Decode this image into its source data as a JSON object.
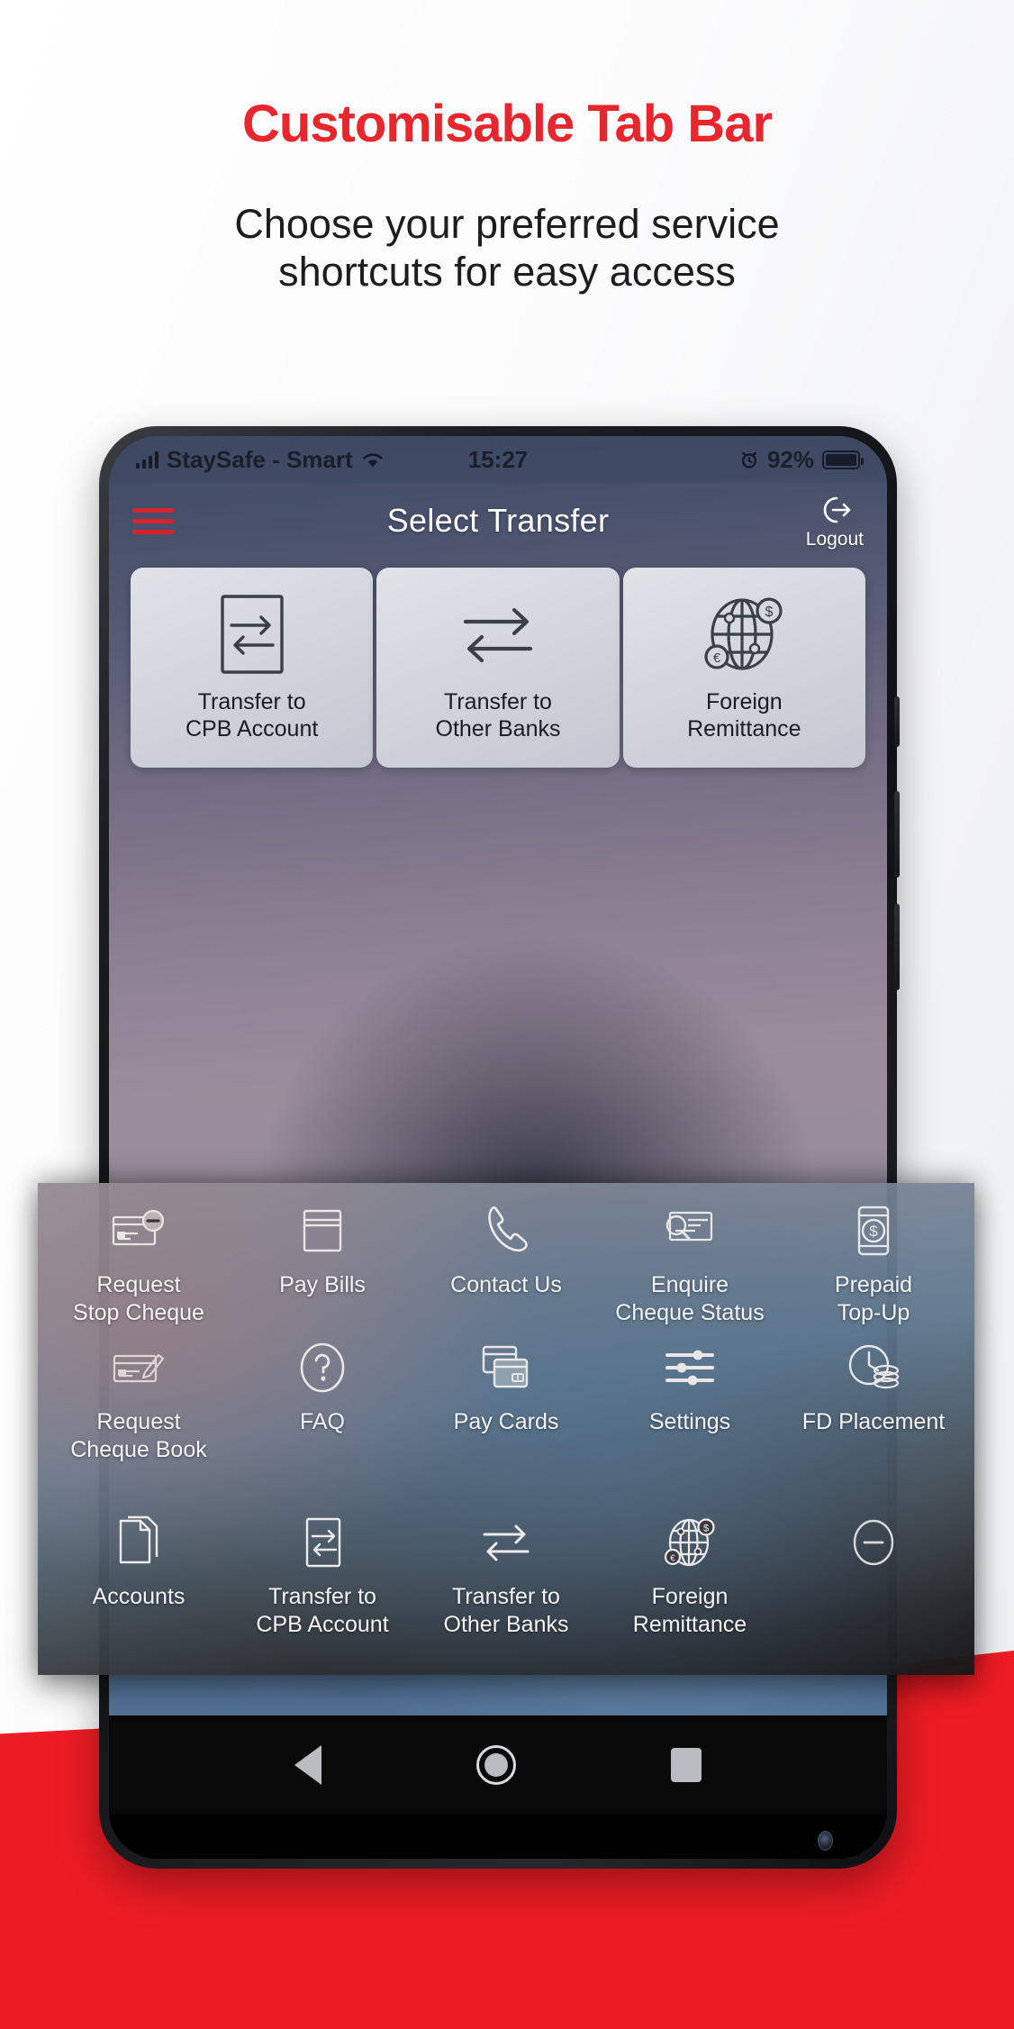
{
  "promo": {
    "title": "Customisable Tab Bar",
    "subtitle_line1": "Choose your preferred service",
    "subtitle_line2": "shortcuts for easy access",
    "title_color": "#e8262d",
    "band_color": "#ed1c24"
  },
  "status_bar": {
    "carrier": "StaySafe - Smart",
    "signal_icon": "signal-bars-icon",
    "wifi_icon": "wifi-icon",
    "time": "15:27",
    "alarm_icon": "alarm-clock-icon",
    "battery_percent": "92%",
    "battery_icon": "battery-full-icon"
  },
  "app_header": {
    "menu_icon": "hamburger-menu-icon",
    "title": "Select Transfer",
    "logout_icon": "logout-icon",
    "logout_label": "Logout"
  },
  "transfer_cards": [
    {
      "icon": "transfer-internal-icon",
      "line1": "Transfer to",
      "line2": "CPB Account"
    },
    {
      "icon": "transfer-external-icon",
      "line1": "Transfer to",
      "line2": "Other Banks"
    },
    {
      "icon": "globe-currency-icon",
      "line1": "Foreign",
      "line2": "Remittance"
    }
  ],
  "tab_panel": {
    "row1": [
      {
        "icon": "stop-cheque-icon",
        "line1": "Request",
        "line2": "Stop Cheque"
      },
      {
        "icon": "pay-bills-icon",
        "line1": "Pay Bills",
        "line2": ""
      },
      {
        "icon": "phone-icon",
        "line1": "Contact Us",
        "line2": ""
      },
      {
        "icon": "cheque-search-icon",
        "line1": "Enquire",
        "line2": "Cheque Status"
      },
      {
        "icon": "prepaid-topup-icon",
        "line1": "Prepaid",
        "line2": "Top-Up"
      }
    ],
    "row2": [
      {
        "icon": "cheque-book-icon",
        "line1": "Request",
        "line2": "Cheque Book"
      },
      {
        "icon": "question-mark-icon",
        "line1": "FAQ",
        "line2": ""
      },
      {
        "icon": "pay-cards-icon",
        "line1": "Pay Cards",
        "line2": ""
      },
      {
        "icon": "settings-sliders-icon",
        "line1": "Settings",
        "line2": ""
      },
      {
        "icon": "fd-placement-icon",
        "line1": "FD Placement",
        "line2": ""
      }
    ],
    "row3": [
      {
        "icon": "accounts-documents-icon",
        "line1": "Accounts",
        "line2": ""
      },
      {
        "icon": "transfer-internal-icon",
        "line1": "Transfer to",
        "line2": "CPB Account"
      },
      {
        "icon": "transfer-external-icon",
        "line1": "Transfer to",
        "line2": "Other Banks"
      },
      {
        "icon": "globe-currency-icon",
        "line1": "Foreign",
        "line2": "Remittance"
      },
      {
        "icon": "remove-circle-icon",
        "line1": "",
        "line2": ""
      }
    ]
  },
  "android_nav": {
    "back_icon": "back-triangle-icon",
    "home_icon": "home-circle-icon",
    "recents_icon": "recents-square-icon"
  }
}
